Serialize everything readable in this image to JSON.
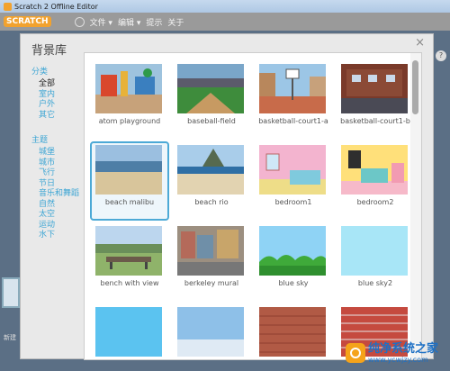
{
  "window": {
    "title": "Scratch 2 Offline Editor"
  },
  "menubar": {
    "logo": "SCRATCH",
    "items": [
      "文件 ▾",
      "编辑 ▾",
      "提示",
      "关于"
    ]
  },
  "modal": {
    "title": "背景库",
    "close": "×",
    "categories_heading": "分类",
    "categories": [
      "全部",
      "室内",
      "户外",
      "其它"
    ],
    "themes_heading": "主题",
    "themes": [
      "城堡",
      "城市",
      "飞行",
      "节日",
      "音乐和舞蹈",
      "自然",
      "太空",
      "运动",
      "水下"
    ],
    "items": [
      {
        "label": "atom playground"
      },
      {
        "label": "baseball-field"
      },
      {
        "label": "basketball-court1-a"
      },
      {
        "label": "basketball-court1-b"
      },
      {
        "label": "beach malibu"
      },
      {
        "label": "beach rio"
      },
      {
        "label": "bedroom1"
      },
      {
        "label": "bedroom2"
      },
      {
        "label": "bench with view"
      },
      {
        "label": "berkeley mural"
      },
      {
        "label": "blue sky"
      },
      {
        "label": "blue sky2"
      },
      {
        "label": ""
      },
      {
        "label": ""
      },
      {
        "label": ""
      },
      {
        "label": ""
      }
    ],
    "selected_label": "beach malibu"
  },
  "side": {
    "help": "?",
    "new_label": "新建"
  },
  "watermark": {
    "text": "纯净系统之家",
    "url": "www.ycwjzy.com"
  },
  "colors": {
    "accent": "#3ca5d4",
    "selection": "#4ca9d6",
    "logo": "#f2a22e"
  }
}
